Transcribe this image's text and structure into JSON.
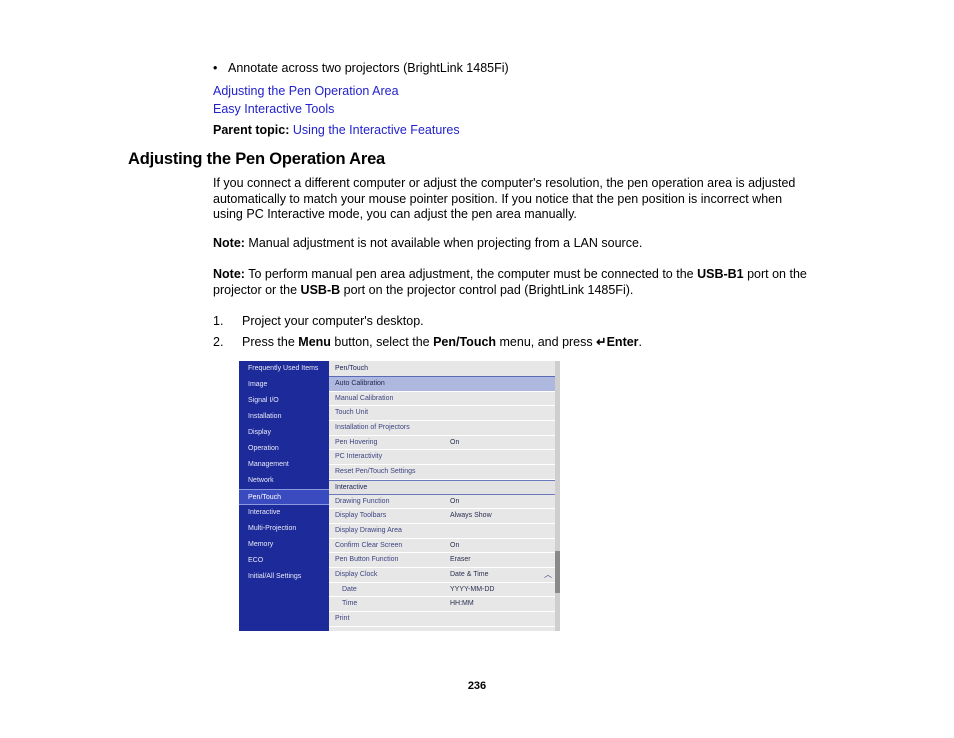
{
  "document": {
    "page_number": "236"
  },
  "intro": {
    "bullet": "Annotate across two projectors (BrightLink 1485Fi)",
    "bullet_marker": "•",
    "links": [
      "Adjusting the Pen Operation Area",
      "Easy Interactive Tools"
    ],
    "parent_topic_label": "Parent topic:",
    "parent_topic_link": "Using the Interactive Features"
  },
  "section": {
    "title": "Adjusting the Pen Operation Area",
    "paragraph": "If you connect a different computer or adjust the computer's resolution, the pen operation area is adjusted automatically to match your mouse pointer position. If you notice that the pen position is incorrect when using PC Interactive mode, you can adjust the pen area manually.",
    "note_label": "Note:",
    "note1_text": " Manual adjustment is not available when projecting from a LAN source.",
    "note2_part1": " To perform manual pen area adjustment, the computer must be connected to the ",
    "note2_bold1": "USB-B1",
    "note2_part2": " port on the projector or the ",
    "note2_bold2": "USB-B",
    "note2_part3": " port on the projector control pad (BrightLink 1485Fi)."
  },
  "steps": [
    {
      "number": "1.",
      "text": "Project your computer's desktop."
    },
    {
      "number": "2.",
      "prefix": "Press the ",
      "bold1": "Menu",
      "mid1": " button, select the ",
      "bold2": "Pen/Touch",
      "mid2": " menu, and press ",
      "enter_glyph": "↵",
      "bold3": "Enter",
      "suffix": "."
    }
  ],
  "osd": {
    "sidebar": [
      {
        "label": "Frequently Used Items",
        "selected": false
      },
      {
        "label": "Image",
        "selected": false
      },
      {
        "label": "Signal I/O",
        "selected": false
      },
      {
        "label": "Installation",
        "selected": false
      },
      {
        "label": "Display",
        "selected": false
      },
      {
        "label": "Operation",
        "selected": false
      },
      {
        "label": "Management",
        "selected": false
      },
      {
        "label": "Network",
        "selected": false
      },
      {
        "label": "Pen/Touch",
        "selected": true
      },
      {
        "label": "Interactive",
        "selected": false
      },
      {
        "label": "Multi-Projection",
        "selected": false
      },
      {
        "label": "Memory",
        "selected": false
      },
      {
        "label": "ECO",
        "selected": false
      },
      {
        "label": "Initial/All Settings",
        "selected": false
      }
    ],
    "panel_title": "Pen/Touch",
    "rows": [
      {
        "label": "Auto Calibration",
        "value": "",
        "state": "highlight"
      },
      {
        "label": "Manual Calibration",
        "value": "",
        "state": "normal"
      },
      {
        "label": "Touch Unit",
        "value": "",
        "state": "normal"
      },
      {
        "label": "Installation of Projectors",
        "value": "",
        "state": "normal"
      },
      {
        "label": "Pen Hovering",
        "value": "On",
        "state": "normal"
      },
      {
        "label": "PC Interactivity",
        "value": "",
        "state": "normal"
      },
      {
        "label": "Reset Pen/Touch Settings",
        "value": "",
        "state": "normal"
      },
      {
        "label": "Interactive",
        "value": "",
        "state": "section"
      },
      {
        "label": "Drawing Function",
        "value": "On",
        "state": "normal"
      },
      {
        "label": "Display Toolbars",
        "value": "Always Show",
        "state": "normal"
      },
      {
        "label": "Display Drawing Area",
        "value": "",
        "state": "normal"
      },
      {
        "label": "Confirm Clear Screen",
        "value": "On",
        "state": "normal"
      },
      {
        "label": "Pen Button Function",
        "value": "Eraser",
        "state": "normal"
      },
      {
        "label": "Display Clock",
        "value": "Date & Time",
        "state": "normal",
        "chevron": "chevron-up-icon",
        "chevron_glyph": "︿"
      },
      {
        "label": "Date",
        "value": "YYYY-MM-DD",
        "state": "normal",
        "indent": true
      },
      {
        "label": "Time",
        "value": "HH:MM",
        "state": "normal",
        "indent": true
      },
      {
        "label": "Print",
        "value": "",
        "state": "normal"
      }
    ]
  },
  "colors": {
    "link": "#2222cc",
    "osd_sidebar_bg": "#1c2a9a",
    "osd_sidebar_selected": "#3a4bc0",
    "osd_row_bg": "#e7e7e7",
    "osd_row_highlight": "#aeb7dd",
    "osd_text": "#3c4480"
  }
}
